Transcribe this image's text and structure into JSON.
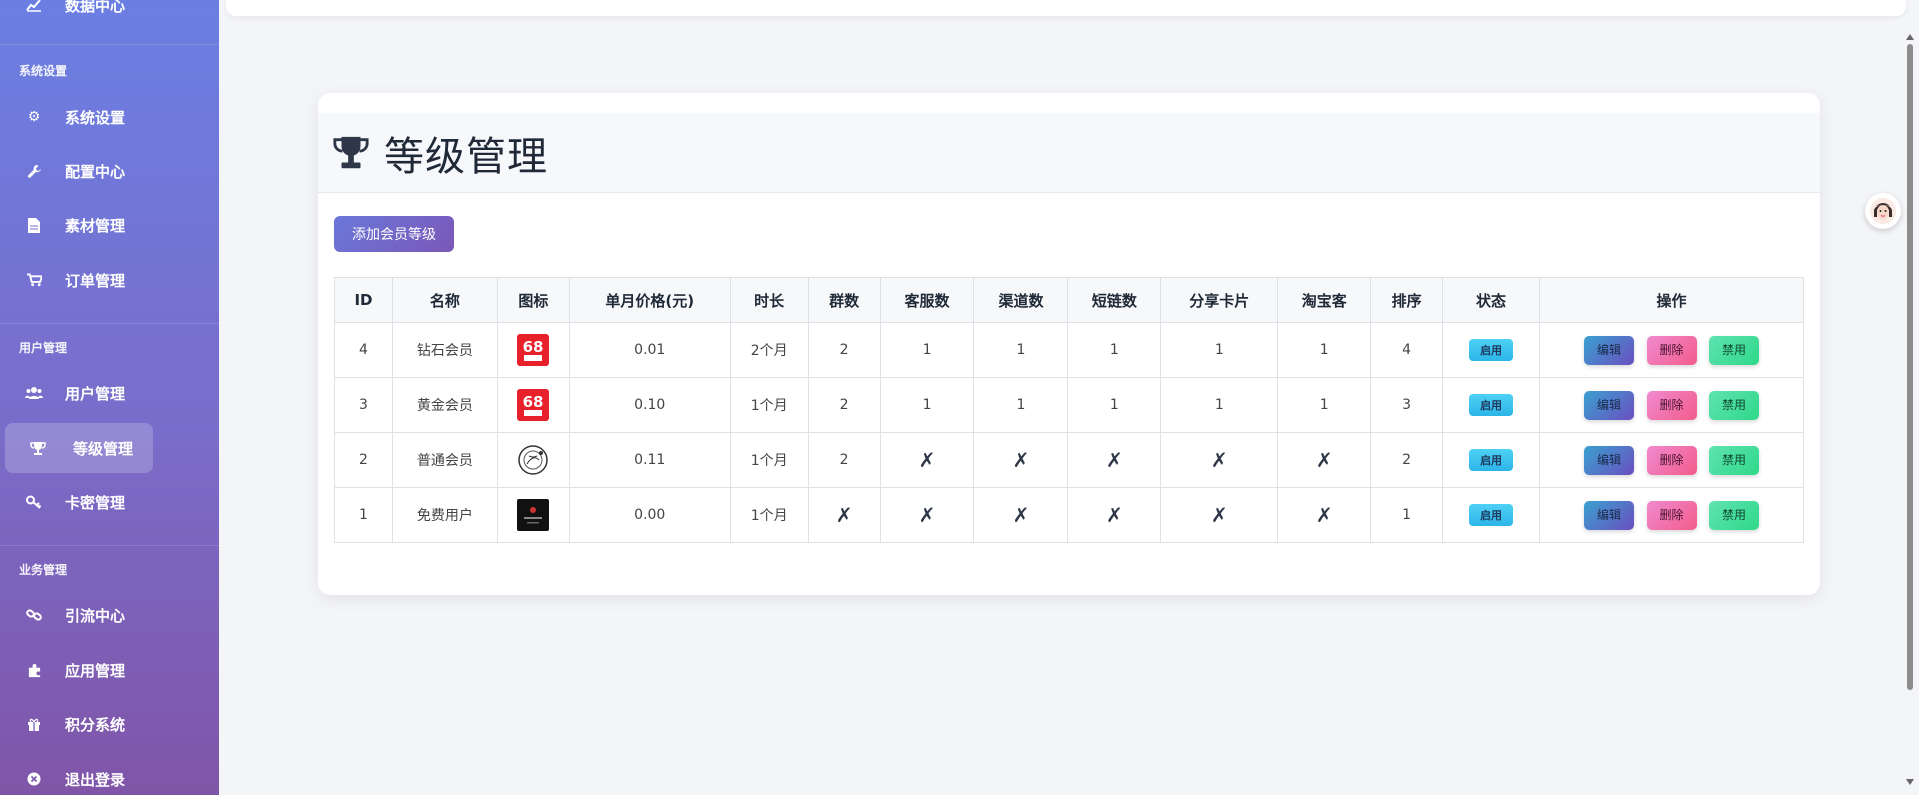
{
  "sidebar": {
    "top_item": "数据中心",
    "sections": [
      {
        "label": "系统设置",
        "items": [
          {
            "label": "系统设置",
            "icon": "gear-icon"
          },
          {
            "label": "配置中心",
            "icon": "wrench-icon"
          },
          {
            "label": "素材管理",
            "icon": "file-icon"
          },
          {
            "label": "订单管理",
            "icon": "cart-icon"
          }
        ]
      },
      {
        "label": "用户管理",
        "items": [
          {
            "label": "用户管理",
            "icon": "users-icon"
          },
          {
            "label": "等级管理",
            "icon": "trophy-icon",
            "active": true
          },
          {
            "label": "卡密管理",
            "icon": "key-icon"
          }
        ]
      },
      {
        "label": "业务管理",
        "items": [
          {
            "label": "引流中心",
            "icon": "link-icon"
          },
          {
            "label": "应用管理",
            "icon": "puzzle-icon"
          },
          {
            "label": "积分系统",
            "icon": "gift-icon"
          },
          {
            "label": "退出登录",
            "icon": "logout-icon"
          }
        ]
      }
    ]
  },
  "page": {
    "title": "等级管理",
    "add_button": "添加会员等级"
  },
  "table": {
    "headers": [
      "ID",
      "名称",
      "图标",
      "单月价格(元)",
      "时长",
      "群数",
      "客服数",
      "渠道数",
      "短链数",
      "分享卡片",
      "淘宝客",
      "排序",
      "状态",
      "操作"
    ],
    "rows": [
      {
        "id": "4",
        "name": "钻石会员",
        "icon": "red-68-icon",
        "price": "0.01",
        "duration": "2个月",
        "groups": "2",
        "cs": "1",
        "channels": "1",
        "shortlinks": "1",
        "cards": "1",
        "taobao": "1",
        "sort": "4",
        "status": "启用"
      },
      {
        "id": "3",
        "name": "黄金会员",
        "icon": "red-68-icon",
        "price": "0.10",
        "duration": "1个月",
        "groups": "2",
        "cs": "1",
        "channels": "1",
        "shortlinks": "1",
        "cards": "1",
        "taobao": "1",
        "sort": "3",
        "status": "启用"
      },
      {
        "id": "2",
        "name": "普通会员",
        "icon": "sketch-circle-icon",
        "price": "0.11",
        "duration": "1个月",
        "groups": "2",
        "cs": "✗",
        "channels": "✗",
        "shortlinks": "✗",
        "cards": "✗",
        "taobao": "✗",
        "sort": "2",
        "status": "启用"
      },
      {
        "id": "1",
        "name": "免费用户",
        "icon": "dark-square-icon",
        "price": "0.00",
        "duration": "1个月",
        "groups": "✗",
        "cs": "✗",
        "channels": "✗",
        "shortlinks": "✗",
        "cards": "✗",
        "taobao": "✗",
        "sort": "1",
        "status": "启用"
      }
    ],
    "actions": {
      "edit": "编辑",
      "delete": "删除",
      "disable": "禁用"
    }
  },
  "colors": {
    "sidebar_top": "#6b7fe3",
    "sidebar_bottom": "#8055a8",
    "badge": "#2bb5e8",
    "edit": "#3aa0d0",
    "delete": "#f25c8a",
    "disable": "#2fd88a"
  }
}
